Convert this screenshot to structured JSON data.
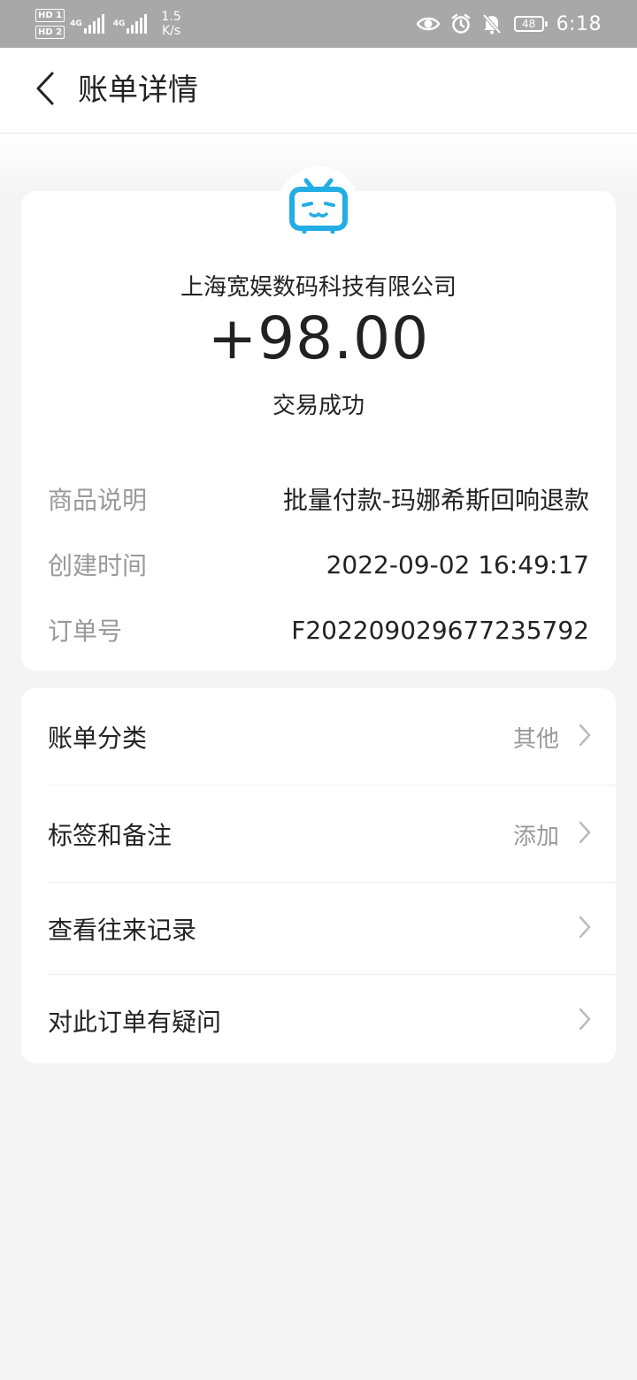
{
  "status_bar": {
    "hd1": "HD 1",
    "hd2": "HD 2",
    "sim1_network": "4G",
    "sim2_network": "4G",
    "speed_value": "1.5",
    "speed_unit": "K/s",
    "battery": "48",
    "time": "6:18",
    "icons": [
      "eye-icon",
      "alarm-icon",
      "mute-bell-icon"
    ]
  },
  "nav": {
    "title": "账单详情",
    "back_icon": "chevron-left-icon"
  },
  "bill": {
    "logo_icon": "bilibili-tv-icon",
    "logo_color": "#23ade5",
    "merchant": "上海宽娱数码科技有限公司",
    "amount": "+98.00",
    "status": "交易成功",
    "details": [
      {
        "label": "商品说明",
        "value": "批量付款-玛娜希斯回响退款"
      },
      {
        "label": "创建时间",
        "value": "2022-09-02 16:49:17"
      },
      {
        "label": "订单号",
        "value": "F2022090296772357­92"
      }
    ]
  },
  "menu": {
    "items": [
      {
        "label": "账单分类",
        "value": "其他"
      },
      {
        "label": "标签和备注",
        "value": "添加"
      },
      {
        "label": "查看往来记录",
        "value": ""
      },
      {
        "label": "对此订单有疑问",
        "value": ""
      }
    ],
    "chevron_icon": "chevron-right-icon"
  }
}
